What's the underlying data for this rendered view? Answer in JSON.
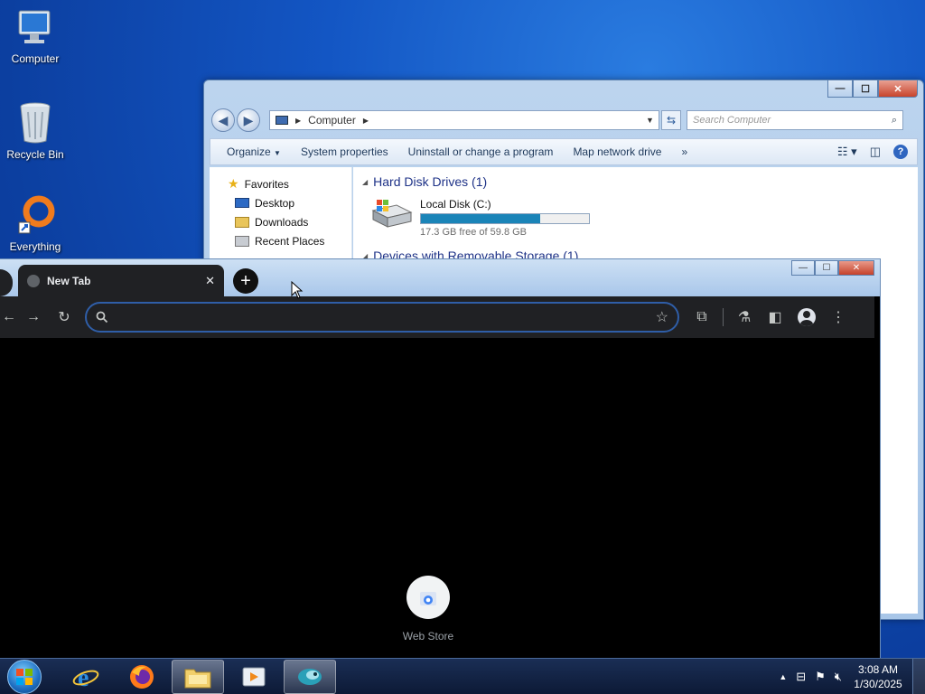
{
  "desktop": {
    "icons": [
      {
        "label": "Computer"
      },
      {
        "label": "Recycle Bin"
      },
      {
        "label": "Everything"
      }
    ]
  },
  "explorer": {
    "address": "Computer",
    "search_placeholder": "Search Computer",
    "toolbar": {
      "organize": "Organize",
      "system_properties": "System properties",
      "uninstall": "Uninstall or change a program",
      "map_drive": "Map network drive",
      "more": "»"
    },
    "nav": {
      "favorites": "Favorites",
      "desktop": "Desktop",
      "downloads": "Downloads",
      "recent_places": "Recent Places"
    },
    "hard_disks_header": "Hard Disk Drives (1)",
    "removable_header": "Devices with Removable Storage (1)",
    "disk": {
      "name": "Local Disk (C:)",
      "free_text": "17.3 GB free of 59.8 GB",
      "used_fraction": 0.71
    },
    "controls": {
      "minimize": "—",
      "maximize": "☐",
      "close": "✕"
    }
  },
  "chrome": {
    "tab_title": "New Tab",
    "tab_close": "✕",
    "new_tab": "+",
    "omnibox_value": "",
    "shortcut_label": "Web Store",
    "controls": {
      "minimize": "—",
      "maximize": "☐",
      "close": "✕"
    }
  },
  "taskbar": {
    "time": "3:08 AM",
    "date": "1/30/2025"
  },
  "colors": {
    "disk_bar": "#1a84b8",
    "chrome_bg": "#000000",
    "chrome_toolbar": "#202124",
    "omnibox_border": "#2f5ea8"
  }
}
